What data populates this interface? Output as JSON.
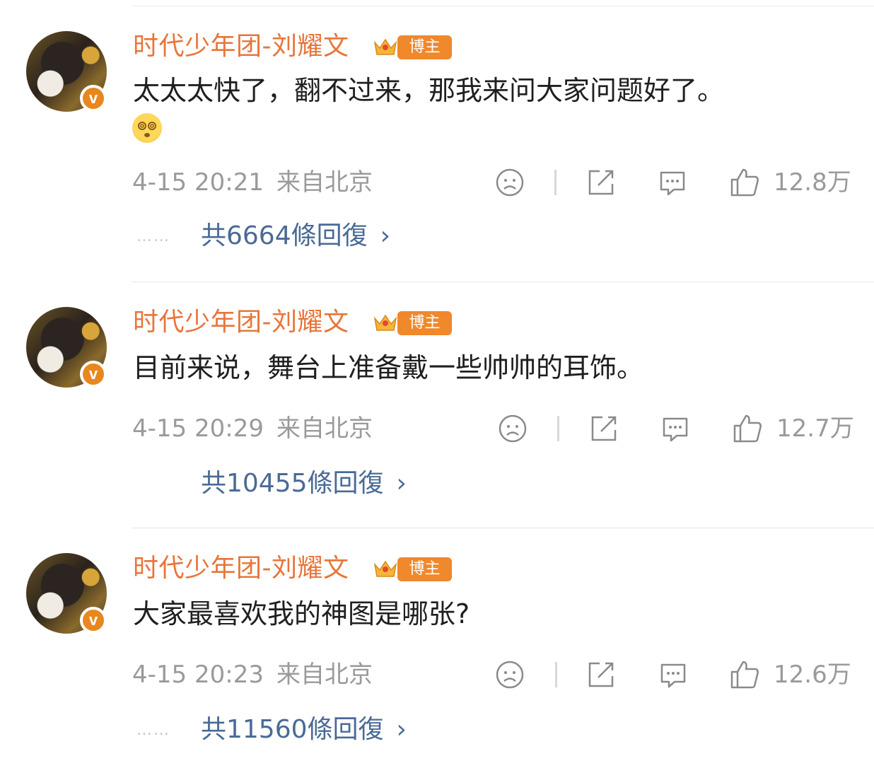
{
  "comments": [
    {
      "username": "时代少年团-刘耀文",
      "badge": "博主",
      "verified_mark": "v",
      "text": "太太太快了，翻不过来，那我来问大家问题好了。",
      "has_emoji": true,
      "emoji": "dizzy-face-emoji",
      "time": "4-15 20:21",
      "location": "来自北京",
      "likes": "12.8万",
      "replies": "共6664條回復",
      "show_dots": true
    },
    {
      "username": "时代少年团-刘耀文",
      "badge": "博主",
      "verified_mark": "v",
      "text": "目前来说，舞台上准备戴一些帅帅的耳饰。",
      "has_emoji": false,
      "time": "4-15 20:29",
      "location": "来自北京",
      "likes": "12.7万",
      "replies": "共10455條回復",
      "show_dots": false
    },
    {
      "username": "时代少年团-刘耀文",
      "badge": "博主",
      "verified_mark": "v",
      "text": "大家最喜欢我的神图是哪张?",
      "has_emoji": false,
      "time": "4-15 20:23",
      "location": "来自北京",
      "likes": "12.6万",
      "replies": "共11560條回復",
      "show_dots": true
    }
  ],
  "dots_text": "……",
  "chevron": "›",
  "colors": {
    "username": "#e8753a",
    "badge": "#f0882c",
    "reply_link": "#4a6a96",
    "meta": "#9a9a9a"
  }
}
